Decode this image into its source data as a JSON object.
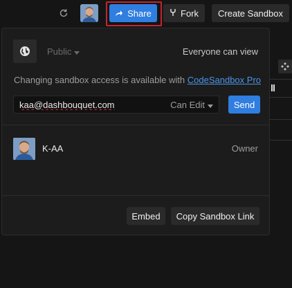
{
  "topbar": {
    "refresh_icon": "refresh-icon",
    "share_label": "Share",
    "fork_label": "Fork",
    "create_label": "Create Sandbox"
  },
  "share_popover": {
    "privacy_value": "Public",
    "audience_text": "Everyone can view",
    "upgrade_prefix": "Changing sandbox access is available with ",
    "upgrade_link": "CodeSandbox Pro",
    "email_value": "kaa@dashbouquet.com",
    "permission_value": "Can Edit",
    "send_label": "Send",
    "members": [
      {
        "name": "K-AA",
        "role": "Owner"
      }
    ],
    "embed_label": "Embed",
    "copy_link_label": "Copy Sandbox Link"
  },
  "colors": {
    "accent": "#2f7ee0",
    "highlight": "#c8242b",
    "link": "#4a96e8"
  }
}
